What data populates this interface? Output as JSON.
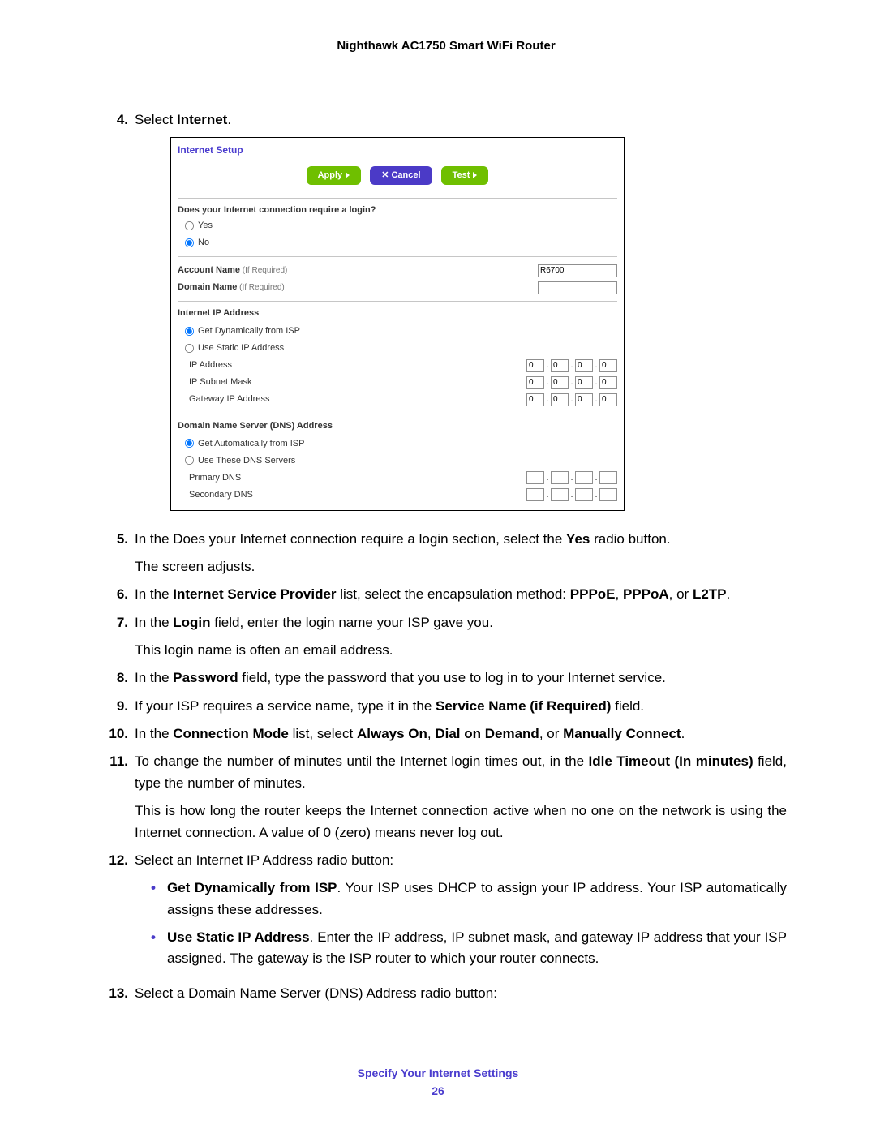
{
  "header": {
    "title": "Nighthawk AC1750 Smart WiFi Router"
  },
  "steps": {
    "s4": {
      "num": "4.",
      "prefix": "Select ",
      "bold": "Internet",
      "suffix": "."
    },
    "s5": {
      "num": "5.",
      "line1_a": "In the Does your Internet connection require a login section, select the ",
      "line1_bold": "Yes",
      "line1_b": " radio button.",
      "line2": "The screen adjusts."
    },
    "s6": {
      "num": "6.",
      "a": "In the ",
      "b1": "Internet Service Provider",
      "c": " list, select the encapsulation method: ",
      "b2": "PPPoE",
      "d": ", ",
      "b3": "PPPoA",
      "e": ", or ",
      "b4": "L2TP",
      "f": "."
    },
    "s7": {
      "num": "7.",
      "a": "In the ",
      "b1": "Login",
      "c": " field, enter the login name your ISP gave you.",
      "line2": "This login name is often an email address."
    },
    "s8": {
      "num": "8.",
      "a": "In the ",
      "b1": "Password",
      "c": " field, type the password that you use to log in to your Internet service."
    },
    "s9": {
      "num": "9.",
      "a": "If your ISP requires a service name, type it in the ",
      "b1": "Service Name (if Required)",
      "c": " field."
    },
    "s10": {
      "num": "10.",
      "a": "In the ",
      "b1": "Connection Mode",
      "c": " list, select ",
      "b2": "Always On",
      "d": ", ",
      "b3": "Dial on Demand",
      "e": ", or ",
      "b4": "Manually Connect",
      "f": "."
    },
    "s11": {
      "num": "11.",
      "a": "To change the number of minutes until the Internet login times out, in the ",
      "b1": "Idle Timeout (In minutes)",
      "c": " field, type the number of minutes.",
      "line2": "This is how long the router keeps the Internet connection active when no one on the network is using the Internet connection. A value of 0 (zero) means never log out."
    },
    "s12": {
      "num": "12.",
      "lead": "Select an Internet IP Address radio button:",
      "b1_t": "Get Dynamically from ISP",
      "b1_r": ". Your ISP uses DHCP to assign your IP address. Your ISP automatically assigns these addresses.",
      "b2_t": "Use Static IP Address",
      "b2_r": ". Enter the IP address, IP subnet mask, and gateway IP address that your ISP assigned. The gateway is the ISP router to which your router connects."
    },
    "s13": {
      "num": "13.",
      "text": "Select a Domain Name Server (DNS) Address radio button:"
    }
  },
  "panel": {
    "title": "Internet Setup",
    "buttons": {
      "apply": "Apply",
      "cancel": "Cancel",
      "test": "Test"
    },
    "login_q": "Does your Internet connection require a login?",
    "yes": "Yes",
    "no": "No",
    "account_name": "Account Name",
    "domain_name": "Domain Name",
    "if_required": "  (If Required)",
    "account_value": "R6700",
    "ip_section": "Internet IP Address",
    "ip_dyn": "Get Dynamically from ISP",
    "ip_static": "Use Static IP Address",
    "ip_address": "IP Address",
    "subnet": "IP Subnet Mask",
    "gateway": "Gateway IP Address",
    "oct": "0",
    "dns_section": "Domain Name Server (DNS) Address",
    "dns_auto": "Get Automatically from ISP",
    "dns_manual": "Use These DNS Servers",
    "pdns": "Primary DNS",
    "sdns": "Secondary DNS"
  },
  "footer": {
    "section": "Specify Your Internet Settings",
    "page": "26"
  }
}
